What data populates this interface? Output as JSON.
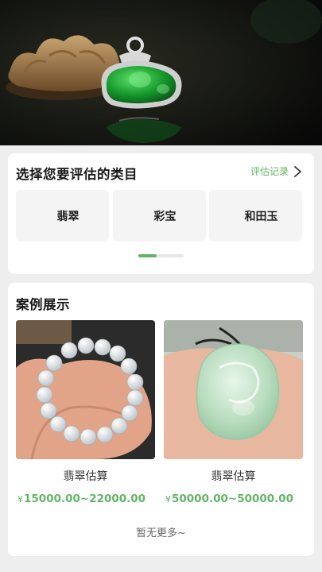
{
  "categories_section": {
    "title": "选择您要评估的类目",
    "history_link": "评估记录",
    "items": [
      {
        "label": "翡翠"
      },
      {
        "label": "彩宝"
      },
      {
        "label": "和田玉"
      }
    ],
    "pager_progress": 0.4
  },
  "cases_section": {
    "title": "案例展示",
    "items": [
      {
        "name": "翡翠估算",
        "currency": "¥",
        "price": "15000.00~22000.00"
      },
      {
        "name": "翡翠估算",
        "currency": "¥",
        "price": "50000.00~50000.00"
      }
    ],
    "footer": "暂无更多~"
  },
  "colors": {
    "accent": "#62b565",
    "jade": "#1f9a3a",
    "background": "#eeeeee"
  }
}
